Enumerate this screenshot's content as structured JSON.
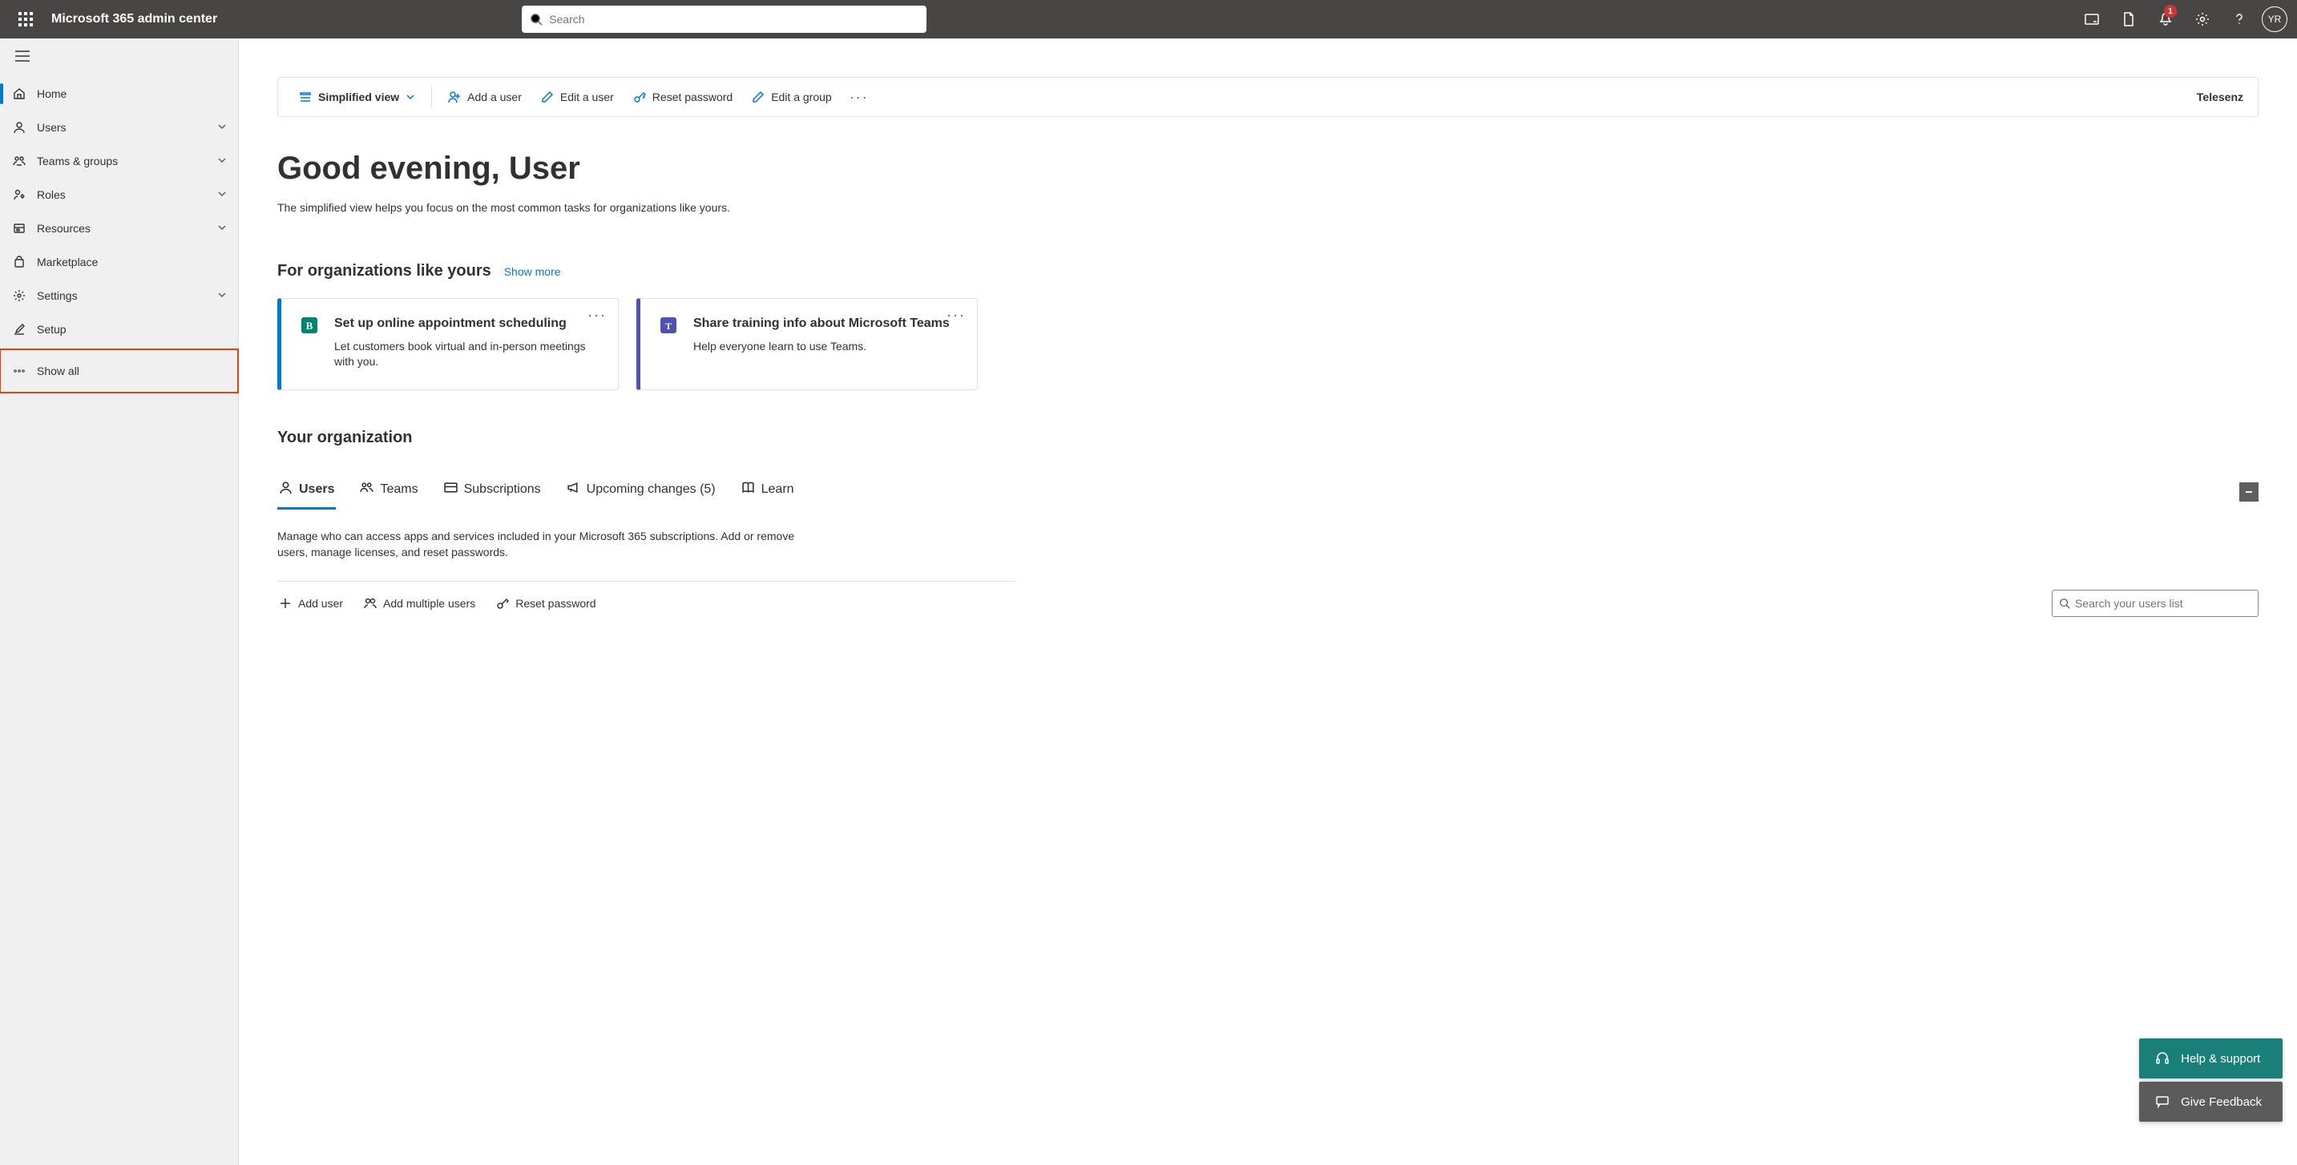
{
  "header": {
    "app_title": "Microsoft 365 admin center",
    "search_placeholder": "Search",
    "notification_count": "1",
    "avatar_initials": "YR"
  },
  "sidebar": {
    "items": [
      {
        "label": "Home",
        "icon": "home",
        "active": true,
        "expandable": false
      },
      {
        "label": "Users",
        "icon": "user",
        "active": false,
        "expandable": true
      },
      {
        "label": "Teams & groups",
        "icon": "teams",
        "active": false,
        "expandable": true
      },
      {
        "label": "Roles",
        "icon": "roles",
        "active": false,
        "expandable": true
      },
      {
        "label": "Resources",
        "icon": "resources",
        "active": false,
        "expandable": true
      },
      {
        "label": "Marketplace",
        "icon": "marketplace",
        "active": false,
        "expandable": false
      },
      {
        "label": "Settings",
        "icon": "settings",
        "active": false,
        "expandable": true
      },
      {
        "label": "Setup",
        "icon": "setup",
        "active": false,
        "expandable": false
      },
      {
        "label": "Show all",
        "icon": "ellipsis",
        "active": false,
        "expandable": false,
        "highlight": true
      }
    ]
  },
  "toolbar": {
    "simplified_view": "Simplified view",
    "add_user": "Add a user",
    "edit_user": "Edit a user",
    "reset_password": "Reset password",
    "edit_group": "Edit a group",
    "tenant": "Telesenz"
  },
  "greeting": {
    "title": "Good evening, User",
    "subtitle": "The simplified view helps you focus on the most common tasks for organizations like yours."
  },
  "suggestions": {
    "heading": "For organizations like yours",
    "show_more": "Show more",
    "cards": [
      {
        "title": "Set up online appointment scheduling",
        "desc": "Let customers book virtual and in-person meetings with you.",
        "accent": "#0078d4",
        "icon": "bookings"
      },
      {
        "title": "Share training info about Microsoft Teams",
        "desc": "Help everyone learn to use Teams.",
        "accent": "#4f52b2",
        "icon": "teams"
      }
    ]
  },
  "org": {
    "heading": "Your organization",
    "tabs": [
      {
        "label": "Users",
        "icon": "user",
        "active": true
      },
      {
        "label": "Teams",
        "icon": "teams",
        "active": false
      },
      {
        "label": "Subscriptions",
        "icon": "card",
        "active": false
      },
      {
        "label": "Upcoming changes (5)",
        "icon": "megaphone",
        "active": false
      },
      {
        "label": "Learn",
        "icon": "book",
        "active": false
      }
    ],
    "tab_desc": "Manage who can access apps and services included in your Microsoft 365 subscriptions. Add or remove users, manage licenses, and reset passwords.",
    "actions": {
      "add_user": "Add user",
      "add_multiple": "Add multiple users",
      "reset_password": "Reset password"
    },
    "user_search_placeholder": "Search your users list"
  },
  "float": {
    "help": "Help & support",
    "feedback": "Give Feedback"
  }
}
